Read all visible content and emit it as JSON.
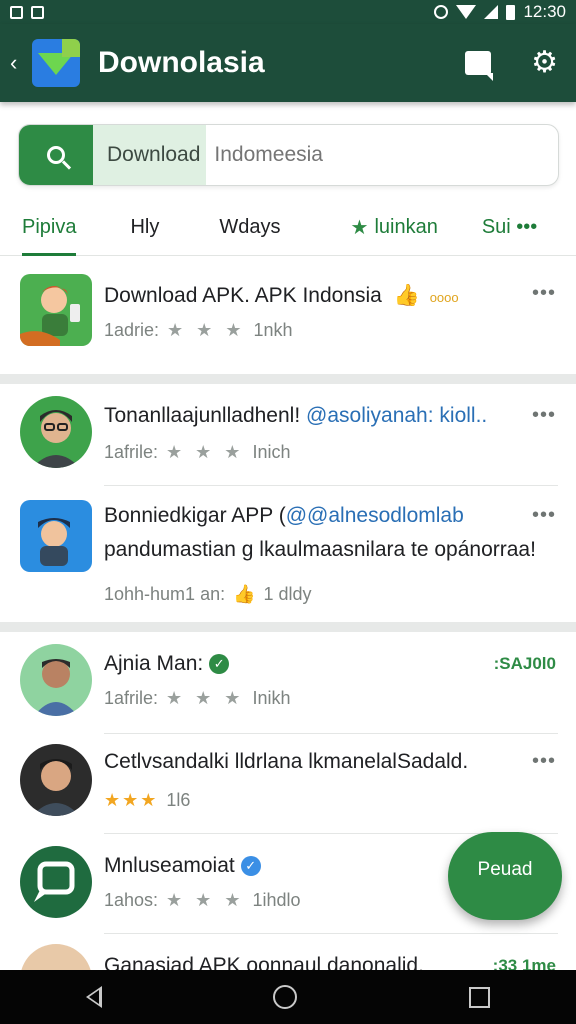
{
  "status_bar": {
    "time": "12:30"
  },
  "app_bar": {
    "title": "Downolasia"
  },
  "search": {
    "chip": "Download",
    "placeholder": "Indomeesia"
  },
  "tabs": [
    "Pipiva",
    "Hly",
    "Wdays",
    "luinkan",
    "Sui •••"
  ],
  "rows": [
    {
      "title": "Download APK. APK Indonsia",
      "badge": "oooo",
      "meta_prefix": "1adrie:",
      "stars": "★ ★ ★",
      "meta_suffix": "1nkh",
      "more": "•••"
    },
    {
      "title": "Tonanllaajunlladhenl!",
      "handle": "@asoliyanah: kioll..",
      "meta_prefix": "1afrile:",
      "stars": "★ ★ ★",
      "meta_suffix": "Inich",
      "more": "•••"
    },
    {
      "title": "Bonniedkigar APP (",
      "handle": "@@alnesodlomlab",
      "line2": "pandumastian g lkaulmaasnilara te opánorraa!",
      "meta": "1ohh-hum1 an:",
      "meta_count": "1 dldy",
      "more": "•••"
    },
    {
      "title": "Ajnia Man:",
      "meta_prefix": "1afrile:",
      "stars": "★ ★ ★",
      "meta_suffix": "Inikh",
      "price": ":SAJ0l0"
    },
    {
      "title": "Cetlvsandalki lldrlana lkmanelalSadald.",
      "stars": "★★★",
      "meta_suffix": "1l6",
      "more": "•••"
    },
    {
      "title": "Mnluseamoiat",
      "meta_prefix": "1ahos:",
      "stars": "★ ★ ★",
      "meta_suffix": "1ihdlo"
    },
    {
      "title": "Ganasiad APK oonnaul danonalid.",
      "price": ":33 1me"
    }
  ],
  "fab": {
    "label": "Peuad"
  },
  "colors": {
    "app_bar": "#1d4d3a",
    "accent": "#2e8b45",
    "handle": "#2a6fb5"
  }
}
